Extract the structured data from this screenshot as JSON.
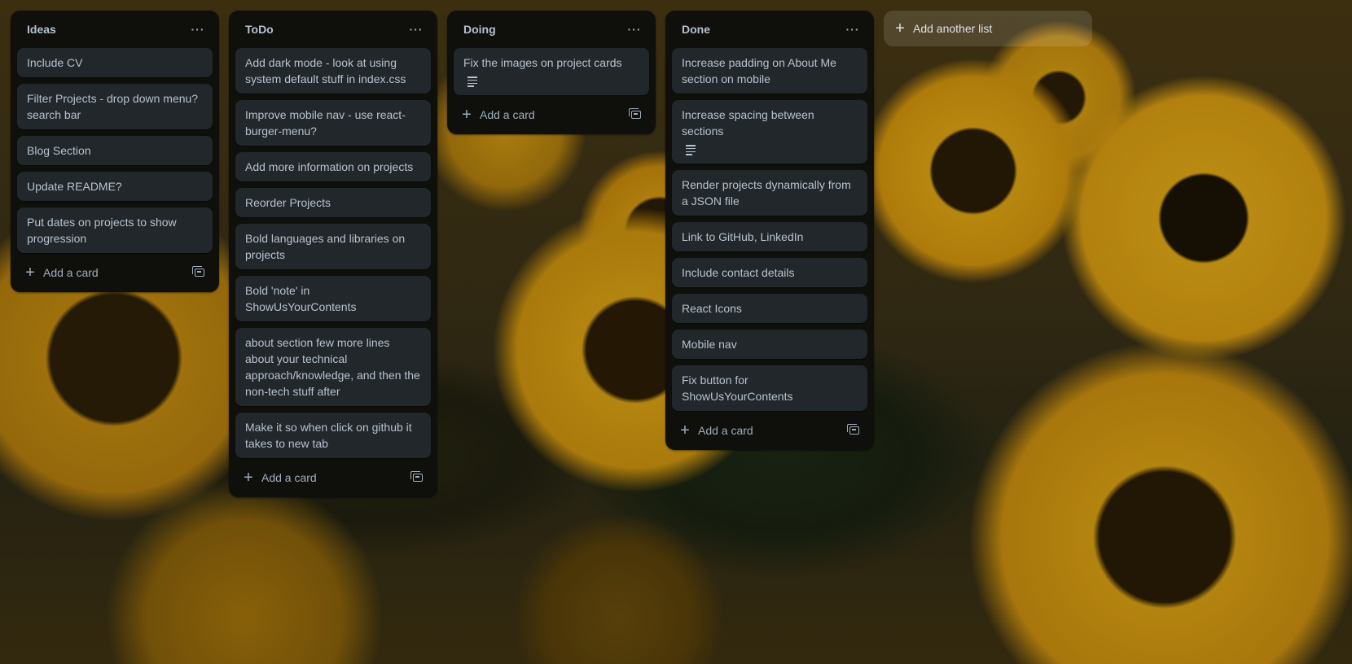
{
  "board": {
    "lists": [
      {
        "title": "Ideas",
        "menu": "···",
        "cards": [
          {
            "text": "Include CV",
            "has_description": false
          },
          {
            "text": "Filter Projects - drop down menu? search bar",
            "has_description": false
          },
          {
            "text": "Blog Section",
            "has_description": false
          },
          {
            "text": "Update README?",
            "has_description": false
          },
          {
            "text": "Put dates on projects to show progression",
            "has_description": false
          }
        ],
        "add_card_label": "Add a card"
      },
      {
        "title": "ToDo",
        "menu": "···",
        "cards": [
          {
            "text": "Add dark mode - look at using system default stuff in index.css",
            "has_description": false
          },
          {
            "text": "Improve mobile nav - use react-burger-menu?",
            "has_description": false
          },
          {
            "text": "Add more information on projects",
            "has_description": false
          },
          {
            "text": "Reorder Projects",
            "has_description": false
          },
          {
            "text": "Bold languages and libraries on projects",
            "has_description": false
          },
          {
            "text": "Bold 'note' in ShowUsYourContents",
            "has_description": false
          },
          {
            "text": "about section few more lines about your technical approach/knowledge, and then the non-tech stuff after",
            "has_description": false
          },
          {
            "text": "Make it so when click on github it takes to new tab",
            "has_description": false
          }
        ],
        "add_card_label": "Add a card"
      },
      {
        "title": "Doing",
        "menu": "···",
        "cards": [
          {
            "text": "Fix the images on project cards",
            "has_description": true
          }
        ],
        "add_card_label": "Add a card"
      },
      {
        "title": "Done",
        "menu": "···",
        "cards": [
          {
            "text": "Increase padding on About Me section on mobile",
            "has_description": false
          },
          {
            "text": "Increase spacing between sections",
            "has_description": true
          },
          {
            "text": "Render projects dynamically from a JSON file",
            "has_description": false
          },
          {
            "text": "Link to GitHub, LinkedIn",
            "has_description": false
          },
          {
            "text": "Include contact details",
            "has_description": false
          },
          {
            "text": "React Icons",
            "has_description": false
          },
          {
            "text": "Mobile nav",
            "has_description": false
          },
          {
            "text": "Fix button for ShowUsYourContents",
            "has_description": false
          }
        ],
        "add_card_label": "Add a card"
      }
    ],
    "add_list_label": "Add another list",
    "icons": {
      "list_menu": "more-horizontal-icon",
      "add": "plus-icon",
      "template": "card-template-icon",
      "description": "description-icon"
    }
  }
}
